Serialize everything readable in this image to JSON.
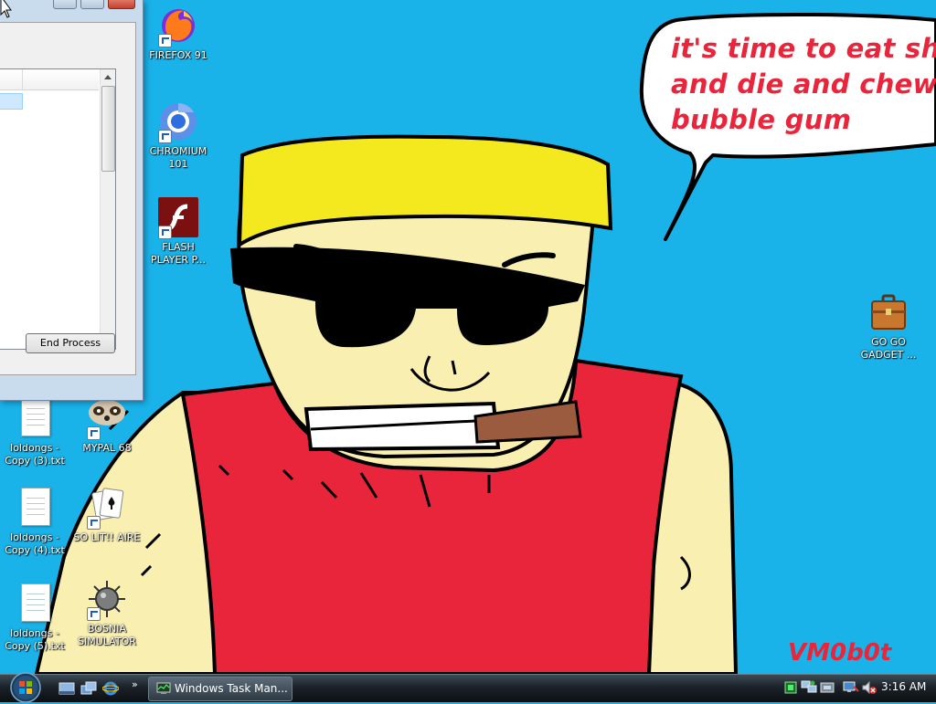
{
  "colors": {
    "desktop_bg": "#19b2e9",
    "bubble_text": "#e8253a",
    "shirt_red": "#e8253a",
    "skin": "#f8efb0",
    "hair_yellow": "#f4e81e"
  },
  "speech_bubble": {
    "line1": "it's time to eat shit",
    "line2": "and die and chew",
    "line3": "bubble gum"
  },
  "signature": "VM0b0t",
  "desktop_icons": [
    {
      "name": "FIREFOX 91",
      "icon": "firefox-icon"
    },
    {
      "name": "CHROMIUM 101",
      "icon": "chromium-icon"
    },
    {
      "name": "FLASH PLAYER P...",
      "icon": "flash-player-icon"
    },
    {
      "name": "GO GO GADGET ...",
      "icon": "briefcase-icon"
    },
    {
      "name": "loldongs - Copy (3).txt",
      "icon": "text-document-icon"
    },
    {
      "name": "MYPAL 68",
      "icon": "mypal-raccoon-icon"
    },
    {
      "name": "loldongs - Copy (4).txt",
      "icon": "text-document-icon"
    },
    {
      "name": "SO LIT!! AIRE",
      "icon": "solitaire-cards-icon"
    },
    {
      "name": "loldongs - Copy (5).txt",
      "icon": "text-document-icon"
    },
    {
      "name": "BOSNIA SIMULATOR",
      "icon": "spiked-mine-icon"
    }
  ],
  "task_manager": {
    "end_process_label": "End Process"
  },
  "taskbar": {
    "task_label": "Windows Task Man...",
    "overflow_chevron": "»",
    "clock": "3:16 AM"
  }
}
